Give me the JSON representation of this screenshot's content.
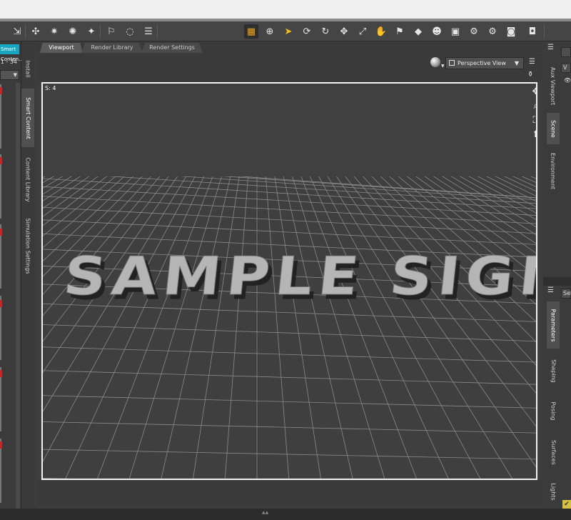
{
  "toolbar": {
    "icons": [
      {
        "name": "select-figure-icon",
        "glyph": "⇲"
      },
      {
        "name": "joint-editor-icon",
        "glyph": "✣"
      },
      {
        "name": "spot-light-icon",
        "glyph": "✷"
      },
      {
        "name": "point-light-icon",
        "glyph": "✺"
      },
      {
        "name": "distant-light-icon",
        "glyph": "✦"
      },
      {
        "name": "camera-add-icon",
        "glyph": "⚐"
      },
      {
        "name": "region-navigator-icon",
        "glyph": "◌"
      },
      {
        "name": "align-icon",
        "glyph": "☰"
      },
      {
        "name": "viewport-grid-icon",
        "glyph": "▦"
      },
      {
        "name": "universal-tool-icon",
        "glyph": "⊕"
      },
      {
        "name": "node-selection-icon",
        "glyph": "➤"
      },
      {
        "name": "translate-tool-icon",
        "glyph": "⟳"
      },
      {
        "name": "rotate-tool-icon",
        "glyph": "↻"
      },
      {
        "name": "move-tool-icon",
        "glyph": "✥"
      },
      {
        "name": "scale-tool-icon",
        "glyph": "⤢"
      },
      {
        "name": "active-pose-icon",
        "glyph": "✋"
      },
      {
        "name": "power-pose-icon",
        "glyph": "⚑"
      },
      {
        "name": "surface-selection-icon",
        "glyph": "◆"
      },
      {
        "name": "figure-shape-icon",
        "glyph": "☻"
      },
      {
        "name": "camera-tool-icon",
        "glyph": "▣"
      },
      {
        "name": "render-settings-icon",
        "glyph": "⚙"
      },
      {
        "name": "iray-settings-icon",
        "glyph": "⚙"
      },
      {
        "name": "render-camera-icon",
        "glyph": "◙"
      },
      {
        "name": "render-icon",
        "glyph": "◘"
      }
    ]
  },
  "left_panel": {
    "header_label": "Smart Conten...",
    "range_label": "1 - 34",
    "dropdown_arrow": "▼"
  },
  "left_tabs": {
    "install": "Install",
    "smart_content": "Smart Content",
    "content_library": "Content Library",
    "simulation_settings": "Simulation Settings"
  },
  "tabs": {
    "viewport": "Viewport",
    "render_library": "Render Library",
    "render_settings": "Render Settings"
  },
  "viewport": {
    "fps": "S: 4",
    "view_mode": "Perspective View",
    "dropdown_arrow": "▼",
    "scene_text": "SAMPLE SIGN",
    "nav_icons": [
      {
        "name": "pan-nav-icon",
        "glyph": "✥"
      },
      {
        "name": "zoom-nav-icon",
        "glyph": "⌕"
      },
      {
        "name": "frame-nav-icon",
        "glyph": "⛶"
      },
      {
        "name": "orbit-nav-icon",
        "glyph": "⬆"
      }
    ]
  },
  "right_panel": {
    "tabs_top": {
      "aux_viewport": "Aux Viewport",
      "scene": "Scene",
      "environment": "Environment"
    },
    "tabs_bottom": {
      "parameters": "Parameters",
      "shaping": "Shaping",
      "posing": "Posing",
      "surfaces": "Surfaces",
      "lights": "Lights"
    },
    "search_box": "V",
    "select_box": "Sel"
  },
  "colors": {
    "accent_cyan": "#17a7c2",
    "active_yellow": "#f2c318",
    "viewport_bg": "#3f3f3f",
    "frame_white": "#f2f2f2"
  }
}
